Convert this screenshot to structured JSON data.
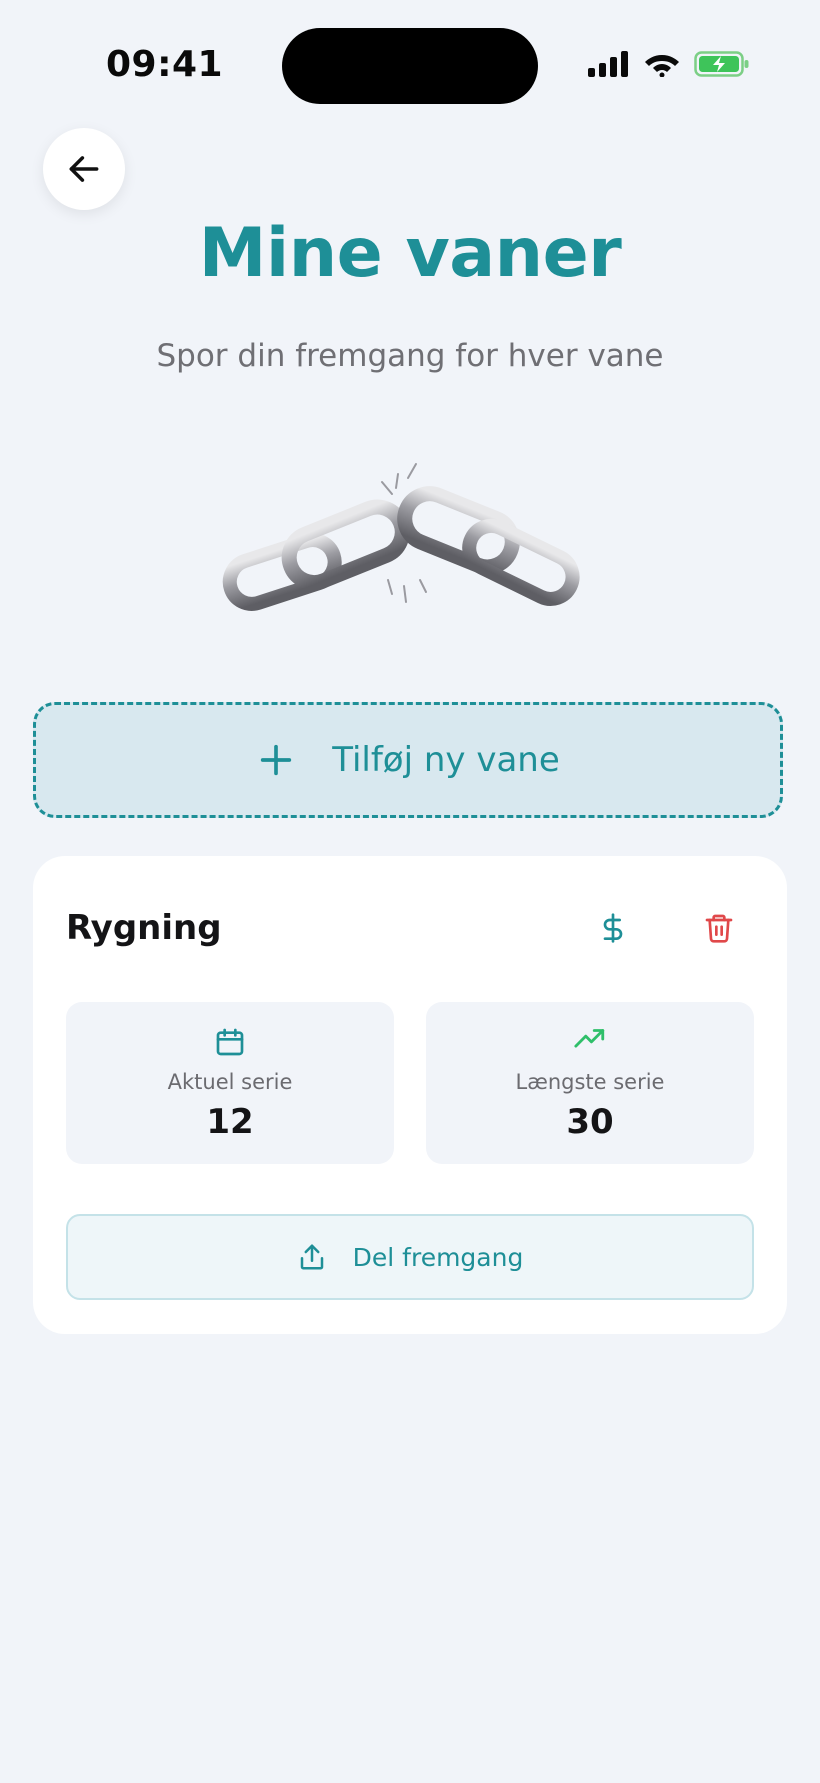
{
  "status_bar": {
    "time": "09:41"
  },
  "header": {
    "title": "Mine vaner",
    "subtitle": "Spor din fremgang for hver vane"
  },
  "add_habit": {
    "label": "Tilføj ny vane"
  },
  "habit": {
    "name": "Rygning",
    "current_streak_label": "Aktuel serie",
    "current_streak_value": "12",
    "longest_streak_label": "Længste serie",
    "longest_streak_value": "30",
    "share_label": "Del fremgang"
  },
  "colors": {
    "accent": "#1e8f97",
    "danger": "#e0484a",
    "trend": "#2fbf6a",
    "background": "#f1f4f9"
  },
  "icons": {
    "back": "arrow-left-icon",
    "add": "plus-icon",
    "money": "dollar-icon",
    "delete": "trash-icon",
    "calendar": "calendar-icon",
    "trend": "trending-up-icon",
    "share": "share-icon"
  }
}
